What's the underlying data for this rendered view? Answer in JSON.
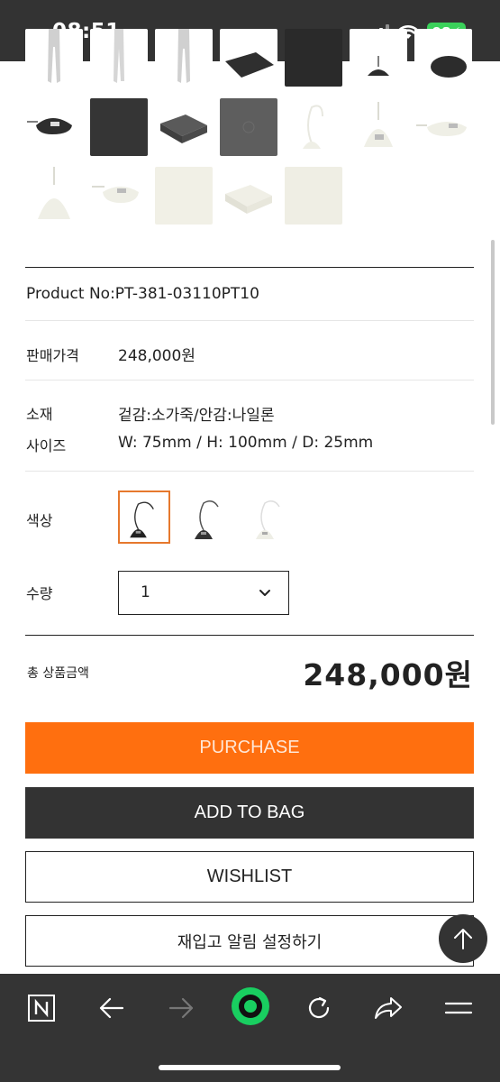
{
  "status_bar": {
    "time": "08:51",
    "battery": "98"
  },
  "product": {
    "number_line": "Product No:PT-381-03110PT10",
    "price_label": "판매가격",
    "price_value": "248,000원",
    "material_label": "소재",
    "material_value": "겉감:소가죽/안감:나일론",
    "size_label": "사이즈",
    "size_value": "W: 75mm / H: 100mm / D: 25mm",
    "color_label": "색상",
    "quantity_label": "수량",
    "quantity_value": "1"
  },
  "total": {
    "label": "총 상품금액",
    "value": "248,000원"
  },
  "buttons": {
    "purchase": "PURCHASE",
    "add_to_bag": "ADD TO BAG",
    "wishlist": "WISHLIST",
    "restock_alert": "재입고 알림 설정하기"
  },
  "colors": {
    "accent": "#ff6f0f",
    "dark": "#333333",
    "selected_border": "#e6782d",
    "battery": "#3ad15a"
  }
}
